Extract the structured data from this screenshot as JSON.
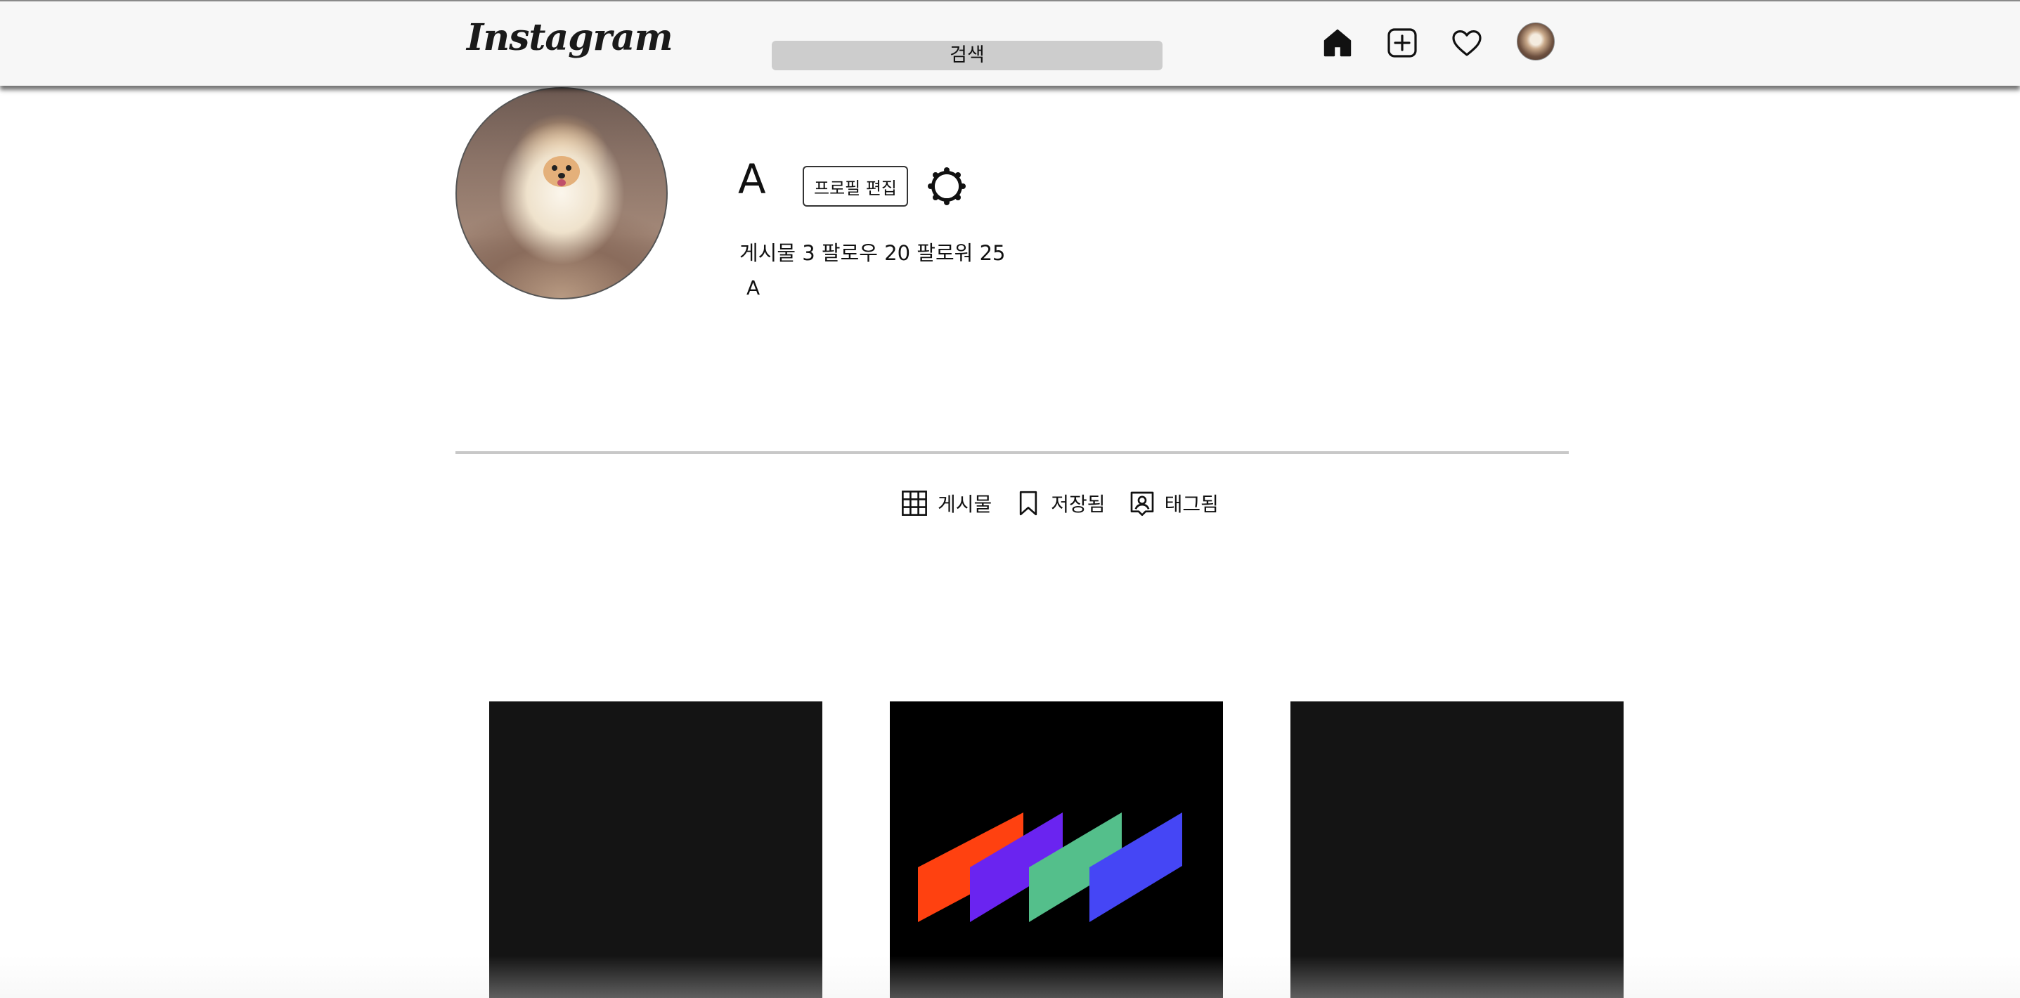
{
  "header": {
    "logo_text": "Instagram",
    "search_placeholder": "검색",
    "nav_icons": [
      "home-icon",
      "add-post-icon",
      "heart-icon",
      "profile-avatar"
    ]
  },
  "profile": {
    "username": "A",
    "edit_button_label": "프로필 편집",
    "stats_text": "게시물 3 팔로우 20 팔로워 25",
    "bio": "A"
  },
  "tabs": [
    {
      "label": "게시물",
      "icon": "grid-icon"
    },
    {
      "label": "저장됨",
      "icon": "bookmark-icon"
    },
    {
      "label": "태그됨",
      "icon": "tagged-user-icon"
    }
  ],
  "posts": [
    {
      "description": "dark tile",
      "color": "#141414"
    },
    {
      "description": "four slanted parallelograms",
      "colors": [
        "#ff4110",
        "#6a24f0",
        "#54bf8b",
        "#4546f5"
      ]
    },
    {
      "description": "dark tile",
      "color": "#141414"
    }
  ]
}
